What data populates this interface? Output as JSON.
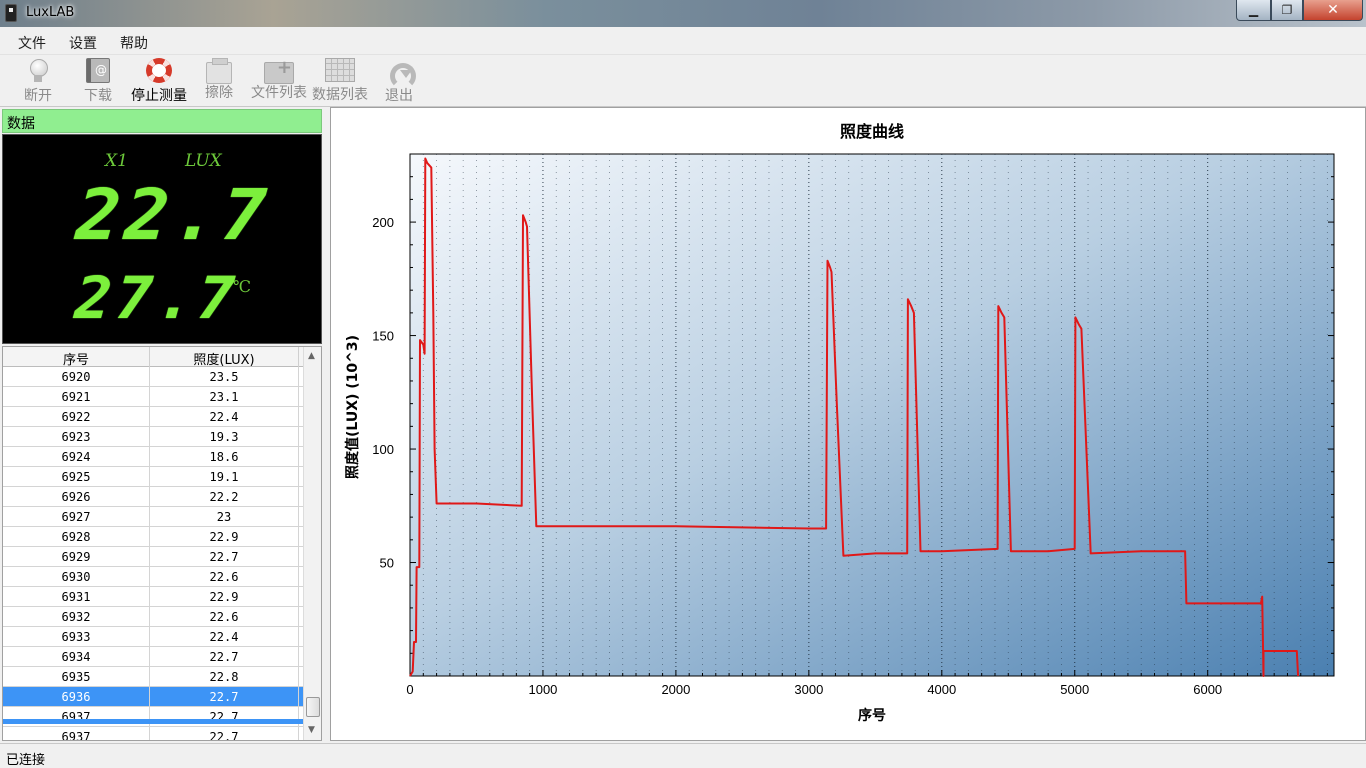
{
  "window": {
    "title": "LuxLAB",
    "minimize": "▁",
    "maximize": "❐",
    "close": "✕"
  },
  "menu": [
    "文件",
    "设置",
    "帮助"
  ],
  "toolbar": [
    {
      "label": "断开",
      "icon": "bulb-icon",
      "enabled": false
    },
    {
      "label": "下载",
      "icon": "book-icon",
      "enabled": false
    },
    {
      "label": "停止测量",
      "icon": "lifebuoy-icon",
      "enabled": true
    },
    {
      "label": "擦除",
      "icon": "eraser-icon",
      "enabled": false
    },
    {
      "label": "文件列表",
      "icon": "folder-add-icon",
      "enabled": false
    },
    {
      "label": "数据列表",
      "icon": "spreadsheet-icon",
      "enabled": false
    },
    {
      "label": "退出",
      "icon": "redo-icon",
      "enabled": false
    }
  ],
  "panel": {
    "header": "数据",
    "meter": {
      "channel": "X1",
      "unit": "LUX",
      "lux": "22.7",
      "temp": "27.7",
      "temp_unit": "℃"
    },
    "table": {
      "headers": [
        "序号",
        "照度(LUX)"
      ],
      "rows": [
        [
          "6920",
          "23.5"
        ],
        [
          "6921",
          "23.1"
        ],
        [
          "6922",
          "22.4"
        ],
        [
          "6923",
          "19.3"
        ],
        [
          "6924",
          "18.6"
        ],
        [
          "6925",
          "19.1"
        ],
        [
          "6926",
          "22.2"
        ],
        [
          "6927",
          "23"
        ],
        [
          "6928",
          "22.9"
        ],
        [
          "6929",
          "22.7"
        ],
        [
          "6930",
          "22.6"
        ],
        [
          "6931",
          "22.9"
        ],
        [
          "6932",
          "22.6"
        ],
        [
          "6933",
          "22.4"
        ],
        [
          "6934",
          "22.7"
        ],
        [
          "6935",
          "22.8"
        ],
        [
          "6936",
          "22.7"
        ],
        [
          "6937",
          "22.7"
        ],
        [
          "6937",
          "22.7"
        ]
      ],
      "selected_row": 16
    }
  },
  "status": "已连接",
  "chart_data": {
    "type": "line",
    "title": "照度曲线",
    "xlabel": "序号",
    "ylabel": "照度值(LUX)  (10^3)",
    "xlim": [
      0,
      6950
    ],
    "ylim": [
      0,
      230
    ],
    "xticks": [
      0,
      1000,
      2000,
      3000,
      4000,
      5000,
      6000
    ],
    "yticks": [
      50,
      100,
      150,
      200
    ],
    "grid": "dotted-vertical",
    "line_color": "#e01818",
    "series": [
      {
        "points": [
          [
            0,
            0
          ],
          [
            20,
            2
          ],
          [
            30,
            15
          ],
          [
            45,
            15
          ],
          [
            50,
            48
          ],
          [
            70,
            48
          ],
          [
            75,
            148
          ],
          [
            100,
            146
          ],
          [
            110,
            142
          ],
          [
            115,
            228
          ],
          [
            130,
            226
          ],
          [
            160,
            224
          ],
          [
            175,
            160
          ],
          [
            185,
            100
          ],
          [
            200,
            76
          ],
          [
            230,
            76
          ],
          [
            500,
            76
          ],
          [
            840,
            75
          ],
          [
            850,
            203
          ],
          [
            870,
            200
          ],
          [
            880,
            198
          ],
          [
            920,
            120
          ],
          [
            950,
            66
          ],
          [
            1200,
            66
          ],
          [
            2000,
            66
          ],
          [
            3000,
            65
          ],
          [
            3130,
            65
          ],
          [
            3140,
            183
          ],
          [
            3160,
            180
          ],
          [
            3170,
            178
          ],
          [
            3210,
            120
          ],
          [
            3260,
            53
          ],
          [
            3500,
            54
          ],
          [
            3740,
            54
          ],
          [
            3745,
            166
          ],
          [
            3770,
            163
          ],
          [
            3790,
            160
          ],
          [
            3840,
            55
          ],
          [
            4000,
            55
          ],
          [
            4420,
            56
          ],
          [
            4425,
            163
          ],
          [
            4450,
            160
          ],
          [
            4470,
            158
          ],
          [
            4520,
            55
          ],
          [
            4800,
            55
          ],
          [
            5000,
            56
          ],
          [
            5005,
            158
          ],
          [
            5030,
            155
          ],
          [
            5050,
            153
          ],
          [
            5120,
            54
          ],
          [
            5500,
            55
          ],
          [
            5830,
            55
          ],
          [
            5840,
            32
          ],
          [
            6000,
            32
          ],
          [
            6400,
            32
          ],
          [
            6410,
            35
          ],
          [
            6420,
            0
          ],
          [
            6420,
            11
          ],
          [
            6500,
            11
          ],
          [
            6670,
            11
          ],
          [
            6680,
            0
          ]
        ]
      }
    ]
  }
}
